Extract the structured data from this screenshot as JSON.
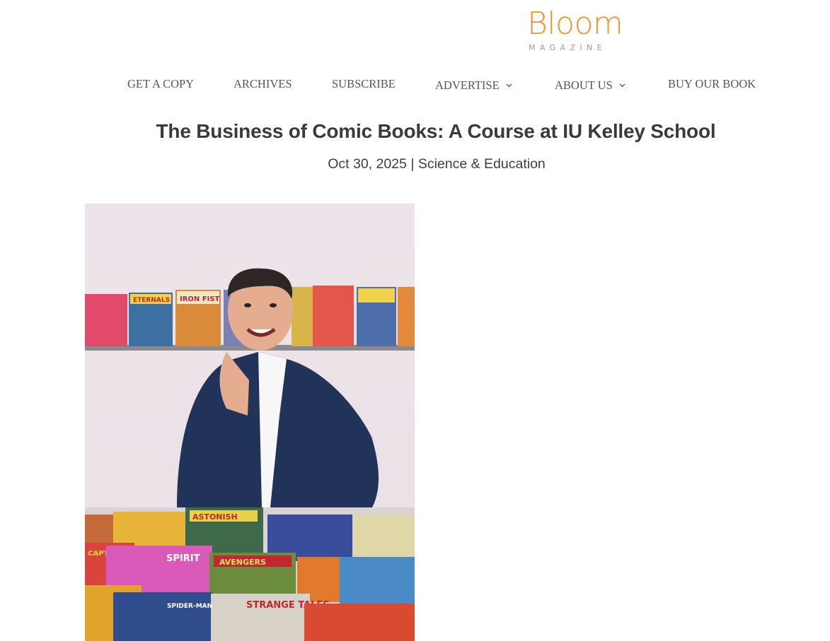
{
  "brand": {
    "name": "Bloom",
    "tagline": "MAGAZINE",
    "accent_color": "#f0952a"
  },
  "nav": {
    "items": [
      {
        "label": "GET A COPY",
        "has_dropdown": false
      },
      {
        "label": "ARCHIVES",
        "has_dropdown": false
      },
      {
        "label": "SUBSCRIBE",
        "has_dropdown": false
      },
      {
        "label": "ADVERTISE",
        "has_dropdown": true
      },
      {
        "label": "ABOUT US",
        "has_dropdown": true
      },
      {
        "label": "BUY OUR BOOK",
        "has_dropdown": false
      }
    ]
  },
  "article": {
    "title": "The Business of Comic Books: A Course at IU Kelley School",
    "date": "Oct 30, 2025",
    "separator": "|",
    "category": "Science & Education",
    "image": {
      "comic_covers_top": [
        "ETERNALS",
        "IRON FIST"
      ],
      "comic_covers_table": [
        "ASTONISH",
        "SPIRIT",
        "AVENGERS",
        "STRANGE TALES",
        "SPIDER-MAN",
        "CAPTAIN"
      ]
    }
  }
}
